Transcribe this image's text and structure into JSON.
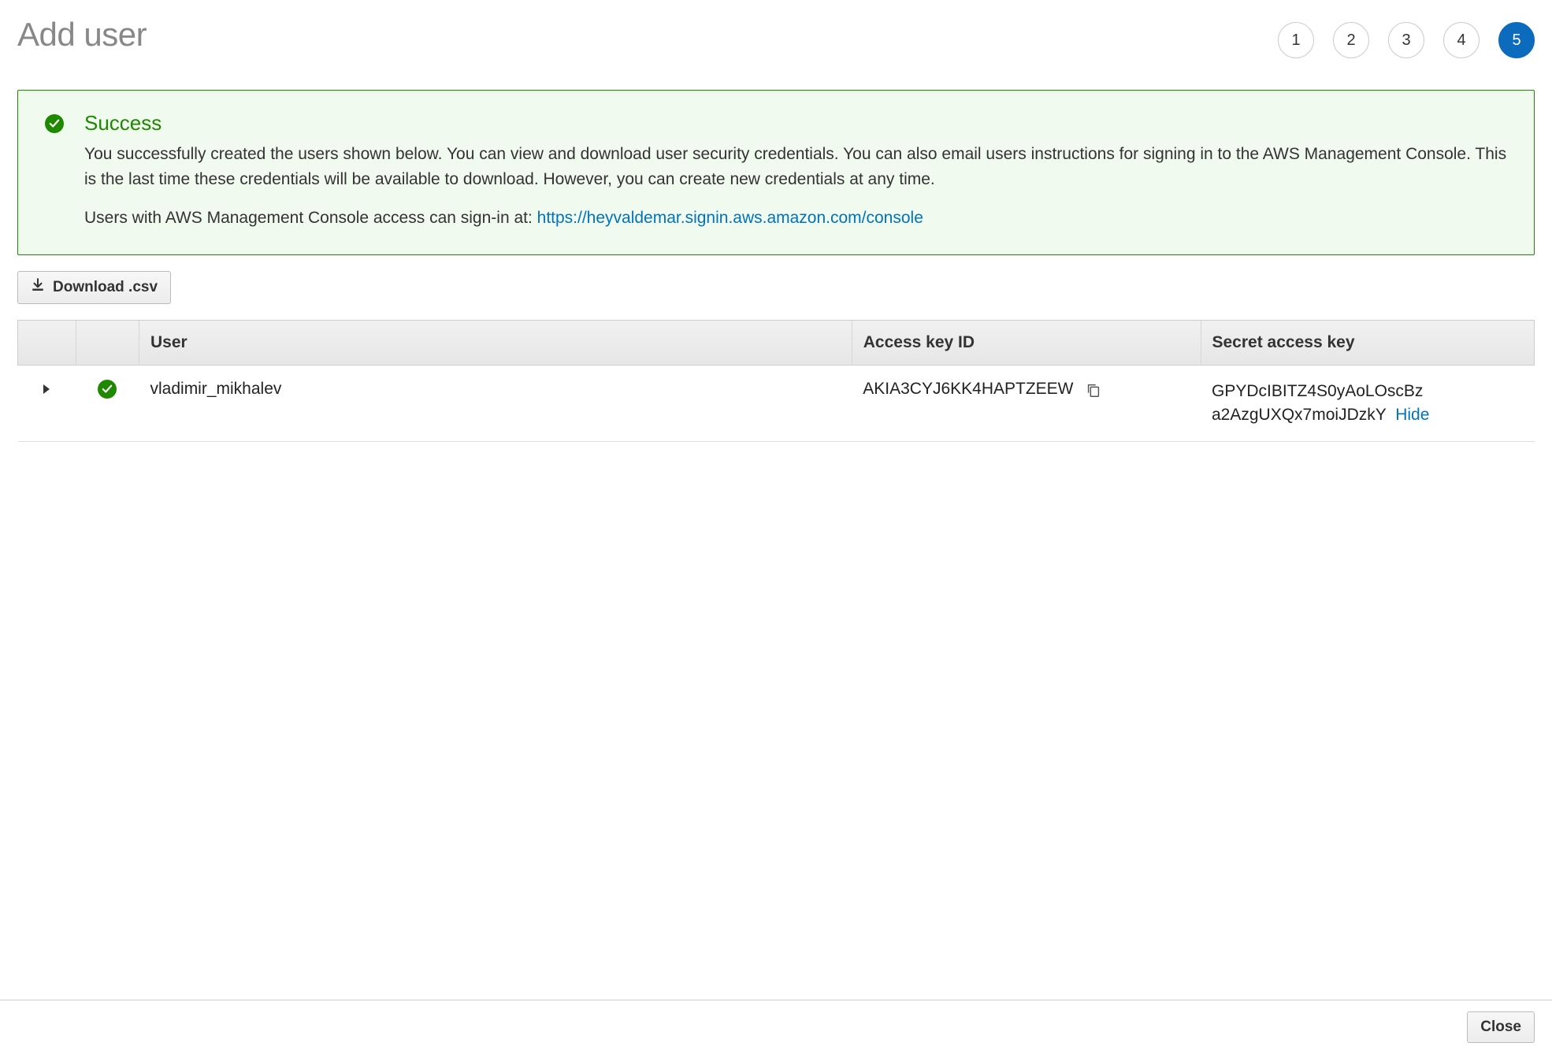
{
  "page": {
    "title": "Add user"
  },
  "stepper": {
    "steps": [
      "1",
      "2",
      "3",
      "4",
      "5"
    ],
    "active_index": 4
  },
  "alert": {
    "heading": "Success",
    "body": "You successfully created the users shown below. You can view and download user security credentials. You can also email users instructions for signing in to the AWS Management Console. This is the last time these credentials will be available to download. However, you can create new credentials at any time.",
    "signin_prefix": "Users with AWS Management Console access can sign-in at: ",
    "signin_url": "https://heyvaldemar.signin.aws.amazon.com/console"
  },
  "toolbar": {
    "download_csv_label": "Download .csv"
  },
  "table": {
    "headers": {
      "user": "User",
      "access_key_id": "Access key ID",
      "secret_access_key": "Secret access key"
    },
    "rows": [
      {
        "user": "vladimir_mikhalev",
        "access_key_id": "AKIA3CYJ6KK4HAPTZEEW",
        "secret_line1": "GPYDcIBITZ4S0yAoLOscBz",
        "secret_line2": "a2AzgUXQx7moiJDzkY",
        "hide_label": "Hide"
      }
    ]
  },
  "footer": {
    "close_label": "Close"
  }
}
